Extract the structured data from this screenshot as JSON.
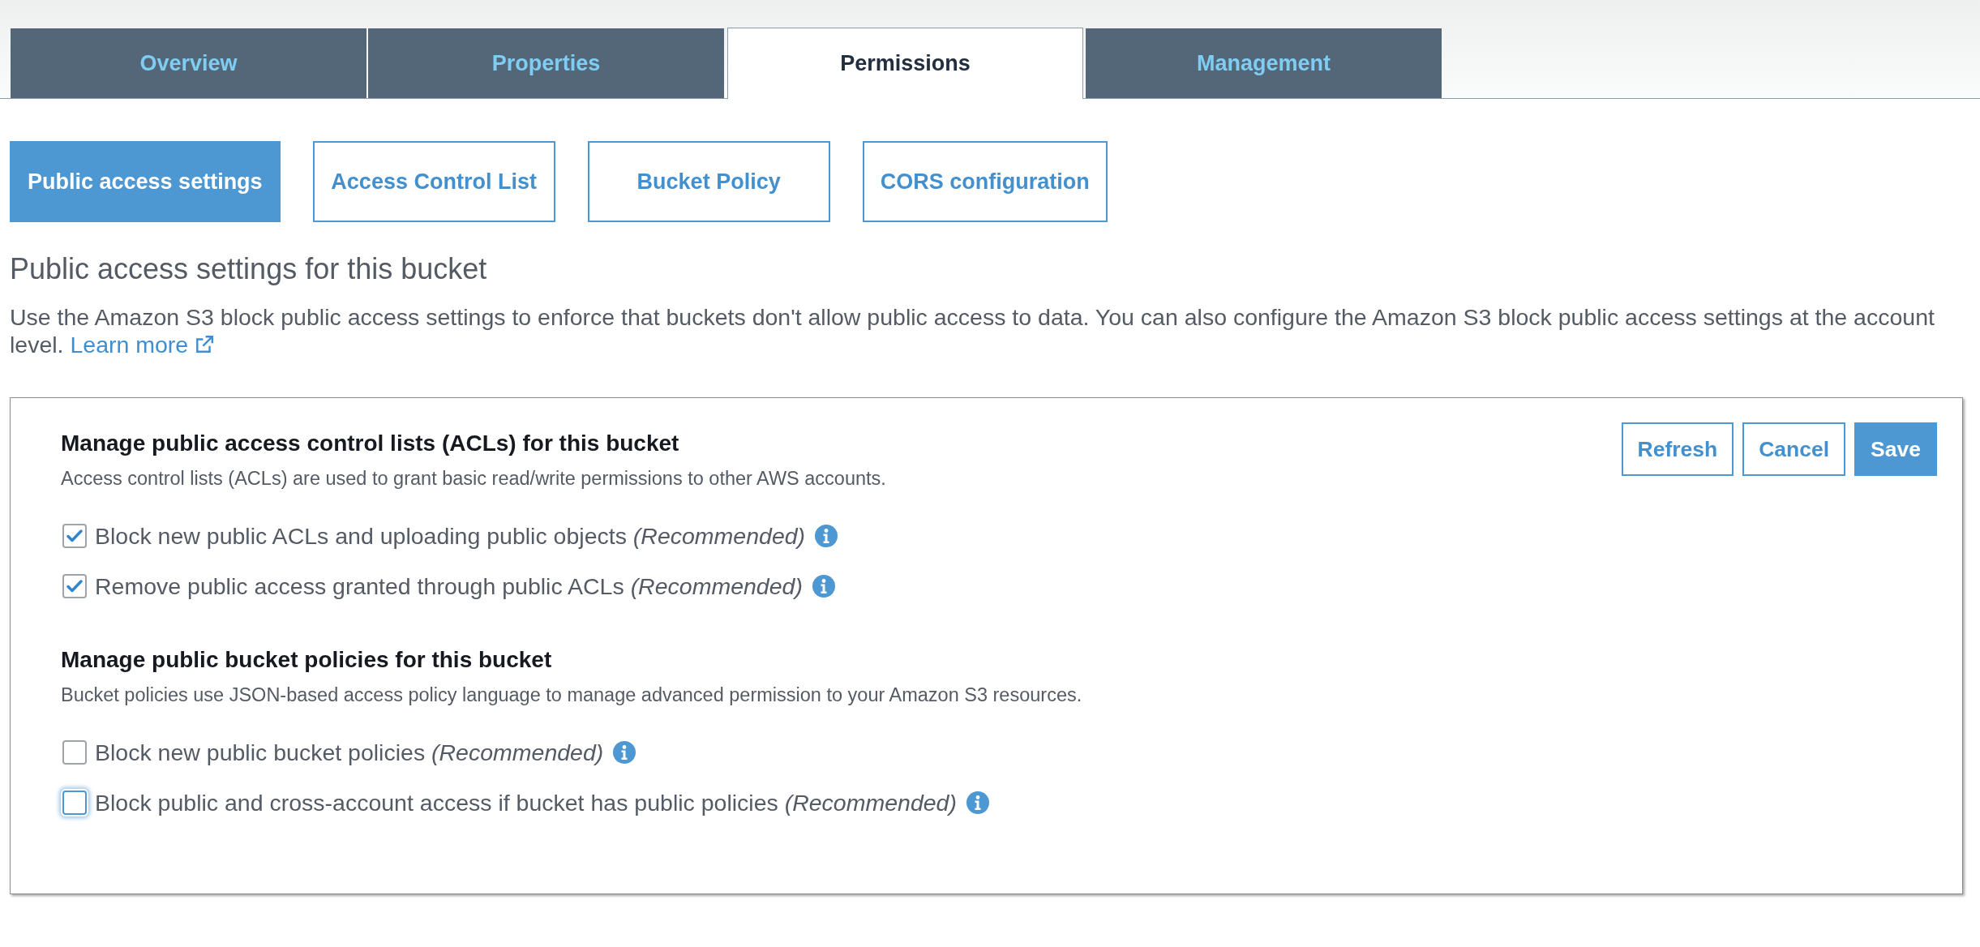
{
  "tabs": [
    {
      "label": "Overview",
      "selected": false
    },
    {
      "label": "Properties",
      "selected": false
    },
    {
      "label": "Permissions",
      "selected": true
    },
    {
      "label": "Management",
      "selected": false
    }
  ],
  "subtabs": [
    {
      "label": "Public access settings",
      "selected": true
    },
    {
      "label": "Access Control List",
      "selected": false
    },
    {
      "label": "Bucket Policy",
      "selected": false
    },
    {
      "label": "CORS configuration",
      "selected": false
    }
  ],
  "heading": "Public access settings for this bucket",
  "intro": {
    "text": "Use the Amazon S3 block public access settings to enforce that buckets don't allow public access to data. You can also configure the Amazon S3 block public access settings at the account level.",
    "link": "Learn more"
  },
  "panel": {
    "buttons": [
      {
        "label": "Refresh",
        "kind": "secondary"
      },
      {
        "label": "Cancel",
        "kind": "secondary"
      },
      {
        "label": "Save",
        "kind": "primary"
      }
    ],
    "sections": [
      {
        "title": "Manage public access control lists (ACLs) for this bucket",
        "description": "Access control lists (ACLs) are used to grant basic read/write permissions to other AWS accounts.",
        "options": [
          {
            "label": "Block new public ACLs and uploading public objects *(Recommended)*",
            "checked": true,
            "focused": false
          },
          {
            "label": "Remove public access granted through public ACLs *(Recommended)*",
            "checked": true,
            "focused": false
          }
        ]
      },
      {
        "title": "Manage public bucket policies for this bucket",
        "description": "Bucket policies use JSON-based access policy language to manage advanced permission to your Amazon S3 resources.",
        "options": [
          {
            "label": "Block new public bucket policies *(Recommended)*",
            "checked": false,
            "focused": false
          },
          {
            "label": "Block public and cross-account access if bucket has public policies *(Recommended)*",
            "checked": false,
            "focused": true
          }
        ]
      }
    ]
  }
}
